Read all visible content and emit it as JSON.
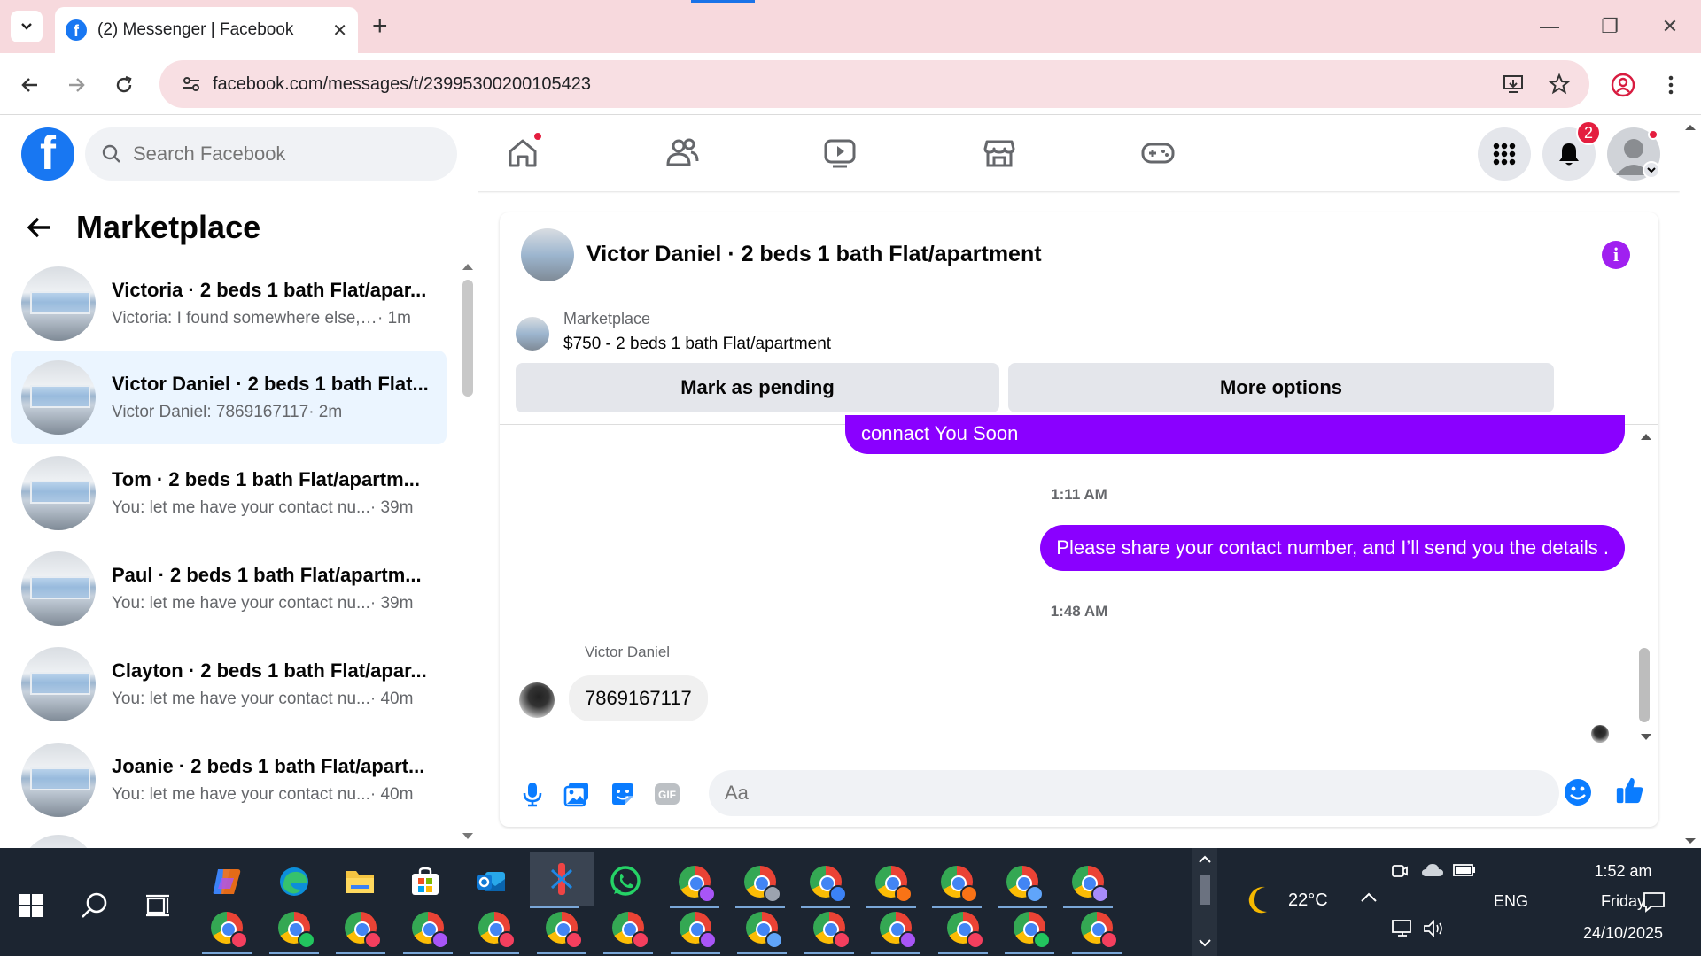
{
  "browser": {
    "tab_title": "(2) Messenger | Facebook",
    "tab_close": "✕",
    "new_tab": "+",
    "url": "facebook.com/messages/t/23995300200105423",
    "minimize": "—",
    "restore": "❐",
    "close": "✕"
  },
  "facebook": {
    "logo_letter": "f",
    "search_placeholder": "Search Facebook",
    "notification_count": "2"
  },
  "sidebar": {
    "title": "Marketplace",
    "conversations": [
      {
        "name": "Victoria · 2 beds 1 bath Flat/apar...",
        "snippet": "Victoria: I found somewhere else, t...",
        "time": " · 1m",
        "active": false
      },
      {
        "name": "Victor Daniel · 2 beds 1 bath Flat...",
        "snippet": "Victor Daniel: 7869167117",
        "time": " · 2m",
        "active": true
      },
      {
        "name": "Tom · 2 beds 1 bath Flat/apartm...",
        "snippet": "You: let me have your contact nu...",
        "time": " · 39m",
        "active": false
      },
      {
        "name": "Paul · 2 beds 1 bath Flat/apartm...",
        "snippet": "You: let me have your contact nu...",
        "time": " · 39m",
        "active": false
      },
      {
        "name": "Clayton · 2 beds 1 bath Flat/apar...",
        "snippet": "You: let me have your contact nu...",
        "time": " · 40m",
        "active": false
      },
      {
        "name": "Joanie · 2 beds 1 bath Flat/apart...",
        "snippet": "You: let me have your contact nu...",
        "time": " · 40m",
        "active": false
      }
    ]
  },
  "chat": {
    "title": "Victor Daniel · 2 beds 1 bath Flat/apartment",
    "marketplace_label": "Marketplace",
    "listing": "$750 - 2 beds 1 bath Flat/apartment",
    "mark_pending": "Mark as pending",
    "more_options": "More options",
    "messages": [
      {
        "type": "out",
        "text": "connact You Soon"
      },
      {
        "type": "time",
        "text": "1:11 AM"
      },
      {
        "type": "out",
        "text": "Please share your contact number, and I’ll send you the details ."
      },
      {
        "type": "time",
        "text": "1:48 AM"
      },
      {
        "type": "sender",
        "text": "Victor Daniel"
      },
      {
        "type": "in",
        "text": "7869167117"
      }
    ],
    "composer_placeholder": "Aa",
    "gif_label": "GIF"
  },
  "taskbar": {
    "weather": "22°C",
    "language": "ENG",
    "time": "1:52 am",
    "day": "Friday",
    "date": "24/10/2025"
  },
  "colors": {
    "facebook_blue": "#1877f2",
    "message_purple": "#8a00ff",
    "badge_red": "#e41e3f",
    "tab_strip_pink": "#f7d9dd"
  }
}
